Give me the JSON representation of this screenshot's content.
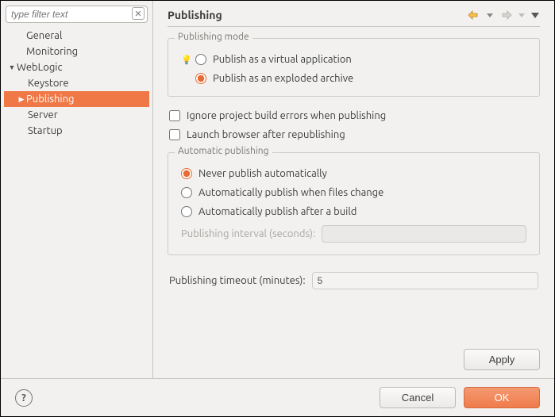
{
  "filter": {
    "placeholder": "type filter text"
  },
  "tree": {
    "general": "General",
    "monitoring": "Monitoring",
    "weblogic": "WebLogic",
    "keystore": "Keystore",
    "publishing": "Publishing",
    "server": "Server",
    "startup": "Startup"
  },
  "page": {
    "title": "Publishing",
    "mode": {
      "legend": "Publishing mode",
      "virtual": "Publish as a virtual application",
      "exploded": "Publish as an exploded archive"
    },
    "ignore_errors": "Ignore project build errors when publishing",
    "launch_browser": "Launch browser after republishing",
    "auto": {
      "legend": "Automatic publishing",
      "never": "Never publish automatically",
      "onchange": "Automatically publish when files change",
      "onbuild": "Automatically publish after a build",
      "interval_label": "Publishing interval (seconds):"
    },
    "timeout_label": "Publishing timeout (minutes):",
    "timeout_value": "5"
  },
  "buttons": {
    "apply": "Apply",
    "cancel": "Cancel",
    "ok": "OK"
  }
}
